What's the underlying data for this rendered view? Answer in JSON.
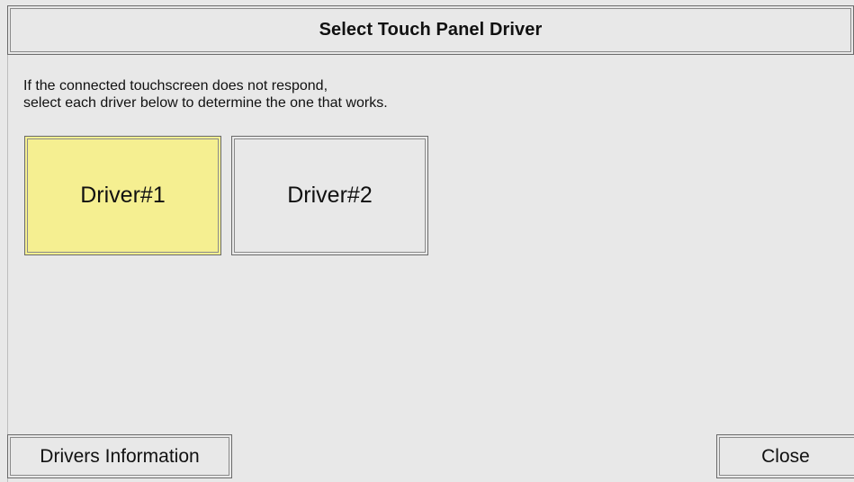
{
  "dialog": {
    "title": "Select Touch Panel Driver",
    "instructions": [
      "If the connected touchscreen does not respond,",
      "select each driver below to determine the one that works."
    ]
  },
  "drivers": [
    {
      "label": "Driver#1",
      "selected": true
    },
    {
      "label": "Driver#2",
      "selected": false
    }
  ],
  "footer": {
    "drivers_info_label": "Drivers Information",
    "close_label": "Close"
  },
  "colors": {
    "background": "#e8e8e8",
    "selected": "#f5ef91",
    "border": "#6a6a6a"
  }
}
